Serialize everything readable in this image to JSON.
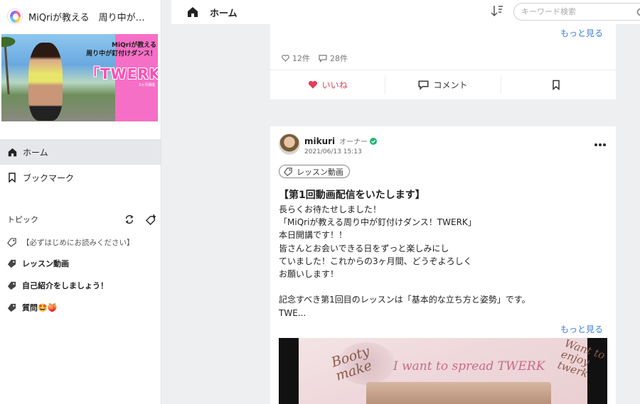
{
  "app": {
    "title": "MiQriが教える　周り中が釘付けダンス！TWERK",
    "banner": {
      "line1": "MiQriが教える",
      "line2": "周り中が釘付けダンス！",
      "headline": "「TWERK」",
      "small": "3ヵ月講座"
    }
  },
  "sidebar": {
    "nav": [
      {
        "label": "ホーム",
        "icon": "home-icon",
        "active": true
      },
      {
        "label": "ブックマーク",
        "icon": "bookmark-icon",
        "active": false
      }
    ],
    "topics_label": "トピック",
    "topics": [
      {
        "label": "【必ずはじめにお読みください】",
        "icon": "tag-outline-icon"
      },
      {
        "label": "レッスン動画",
        "icon": "tag-filled-icon"
      },
      {
        "label": "自己紹介をしましょう！",
        "icon": "tag-filled-icon"
      },
      {
        "label": "質問🤩🍑",
        "icon": "tag-filled-icon"
      }
    ]
  },
  "header": {
    "title": "ホーム",
    "search_placeholder": "キーワード検索"
  },
  "feed": {
    "prev_post": {
      "more_label": "もっと見る",
      "likes": "12件",
      "comments": "28件",
      "like_label": "いいね",
      "comment_label": "コメント"
    },
    "post": {
      "author": "mikuri",
      "role": "オーナー",
      "date": "2021/06/13 15:13",
      "tag": "レッスン動画",
      "title": "【第1回動画配信をいたします】",
      "body_lines": [
        "長らくお待たせしました！",
        "「MiQriが教える周り中が釘付けダンス！TWERK」",
        "本日開講です！！",
        "皆さんとお会いできる日をずっと楽しみにし",
        "ていました！これからの3ヶ月間、どうぞよろしく",
        "お願いします！",
        "",
        "記念すべき第1回目のレッスンは「基本的な立ち方と姿勢」です。",
        "TWE..."
      ],
      "more_label": "もっと見る",
      "image_text": {
        "left": "Booty make",
        "center": "I want to spread TWERK",
        "right": "Want to enjoy twerk"
      }
    }
  },
  "colors": {
    "accent_link": "#3b7ed6",
    "like_red": "#e0405a",
    "banner_pink": "#f56fc6",
    "verified_green": "#22b573"
  }
}
